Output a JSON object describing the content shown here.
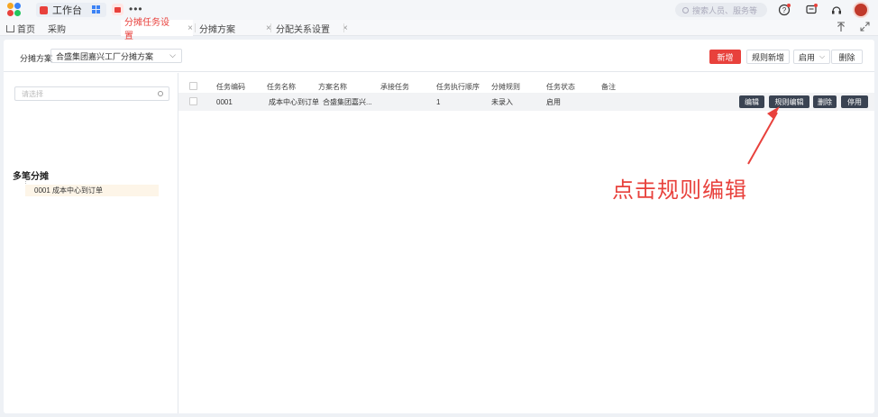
{
  "topbar": {
    "workbench_label": "工作台",
    "more": "•••",
    "search_placeholder": "搜索人员、服务等"
  },
  "tabs": [
    {
      "label": "首页"
    },
    {
      "label": "采购"
    },
    {
      "label": "分摊任务设置",
      "active": true,
      "close": "×"
    },
    {
      "label": "分摊方案",
      "close": "×"
    },
    {
      "label": "分配关系设置",
      "close": "×"
    }
  ],
  "toolbar": {
    "scheme_label": "分摊方案",
    "scheme_value": "合盛集团嘉兴工厂分摊方案",
    "new_label": "新增",
    "rule_new_label": "规则新增",
    "enable_label": "启用",
    "delete_label": "删除"
  },
  "left_panel": {
    "search_placeholder": "请选择",
    "tree_title": "多笔分摊",
    "tree_item": "0001 成本中心到订单"
  },
  "table": {
    "headers": [
      "任务编码",
      "任务名称",
      "方案名称",
      "承接任务",
      "任务执行顺序",
      "分摊规则",
      "任务状态",
      "备注"
    ],
    "rows": [
      {
        "code": "0001",
        "name": "成本中心到订单",
        "scheme": "合盛集团嘉兴...",
        "inherit": "",
        "order": "1",
        "rule": "未录入",
        "status": "启用",
        "remark": "",
        "actions": [
          "编辑",
          "规则编辑",
          "删除",
          "停用"
        ]
      }
    ]
  },
  "annotation": {
    "text": "点击规则编辑",
    "color": "#e8413c"
  },
  "colors": {
    "accent": "#e8413c",
    "dark_button": "#3a4352"
  }
}
